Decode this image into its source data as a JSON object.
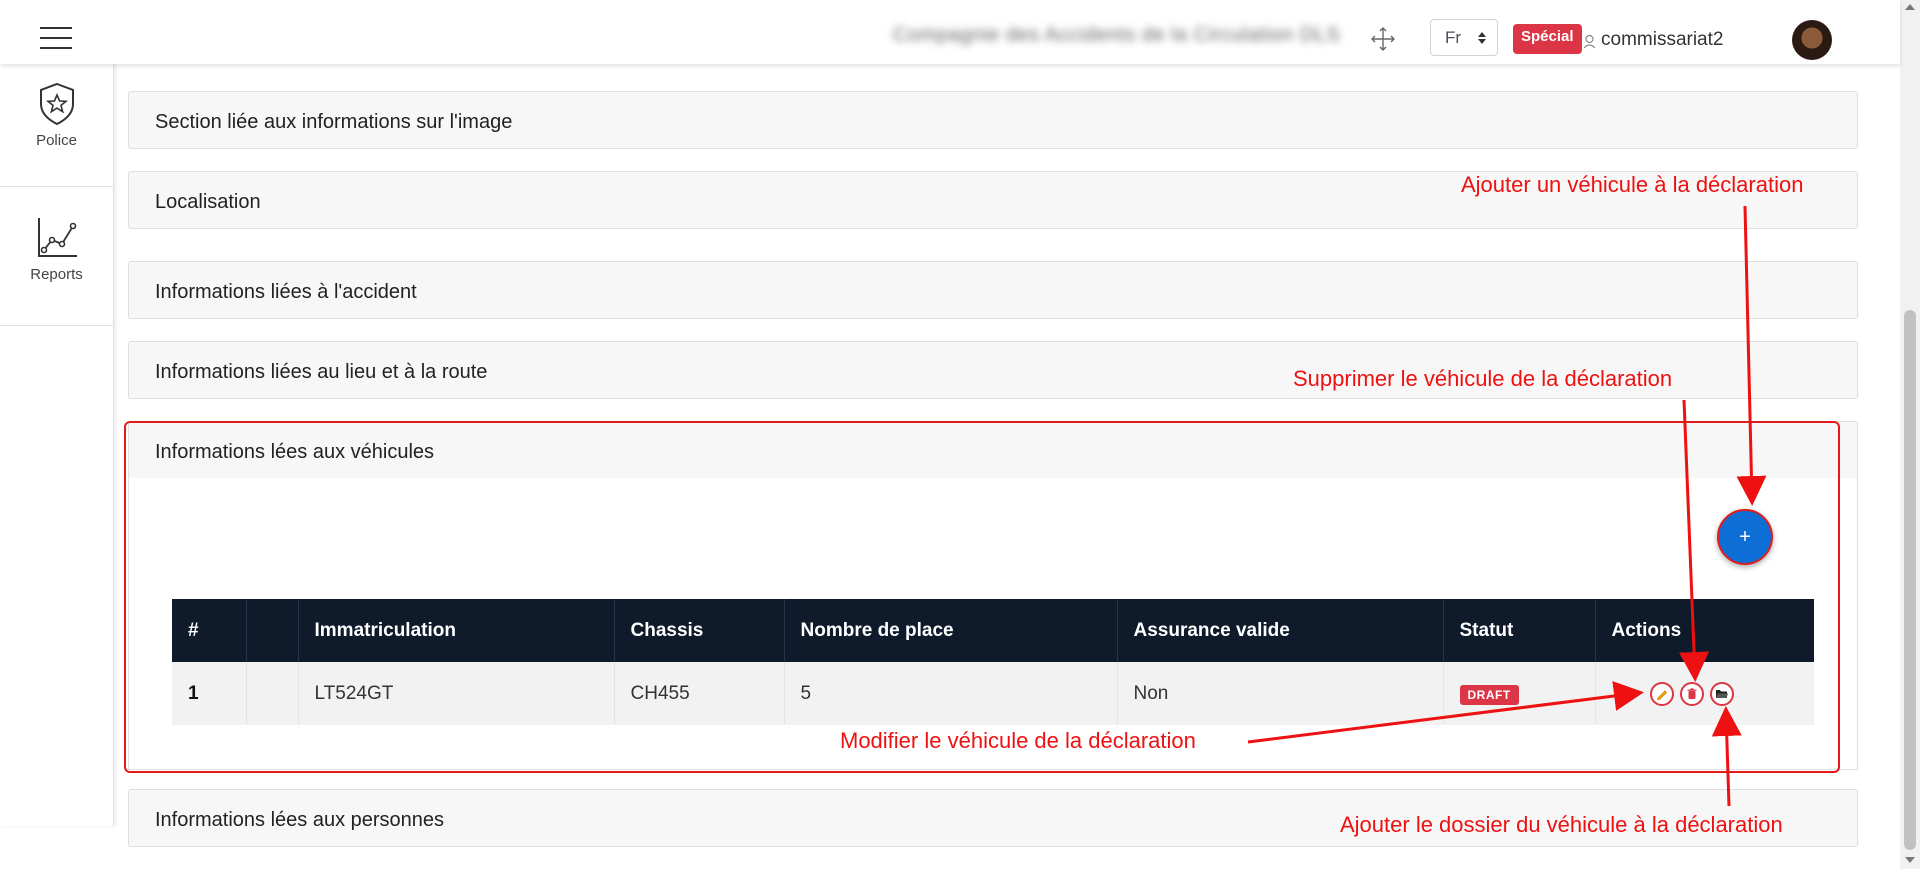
{
  "header": {
    "company": "Compagnie des Accidents de la Circulation DLS",
    "language": "Fr",
    "badge": "Spécial",
    "username": "commissariat2"
  },
  "sidebar": {
    "items": [
      {
        "label": "Police",
        "icon": "police-badge-icon"
      },
      {
        "label": "Reports",
        "icon": "reports-chart-icon"
      }
    ]
  },
  "sections": [
    {
      "title": "Section liée aux informations sur l'image"
    },
    {
      "title": "Localisation"
    },
    {
      "title": "Informations liées à l'accident"
    },
    {
      "title": "Informations liées au lieu et à la route"
    },
    {
      "title": "Informations lées aux véhicules"
    },
    {
      "title": "Informations lées aux personnes"
    }
  ],
  "vehicles": {
    "add_button_label": "+",
    "columns": [
      "#",
      "",
      "Immatriculation",
      "Chassis",
      "Nombre de place",
      "Assurance valide",
      "Statut",
      "Actions"
    ],
    "rows": [
      {
        "index": "1",
        "extra": "",
        "immatriculation": "LT524GT",
        "chassis": "CH455",
        "places": "5",
        "assurance": "Non",
        "statut": "DRAFT"
      }
    ]
  },
  "annotations": {
    "add": "Ajouter un véhicule à la déclaration",
    "delete": "Supprimer le véhicule de la déclaration",
    "edit": "Modifier le véhicule de la déclaration",
    "folder": "Ajouter le dossier du véhicule à la déclaration"
  },
  "colors": {
    "accent": "#dc3545",
    "table_header": "#0f1a2a",
    "fab": "#0d6fd6",
    "annotation": "#ee1111"
  }
}
